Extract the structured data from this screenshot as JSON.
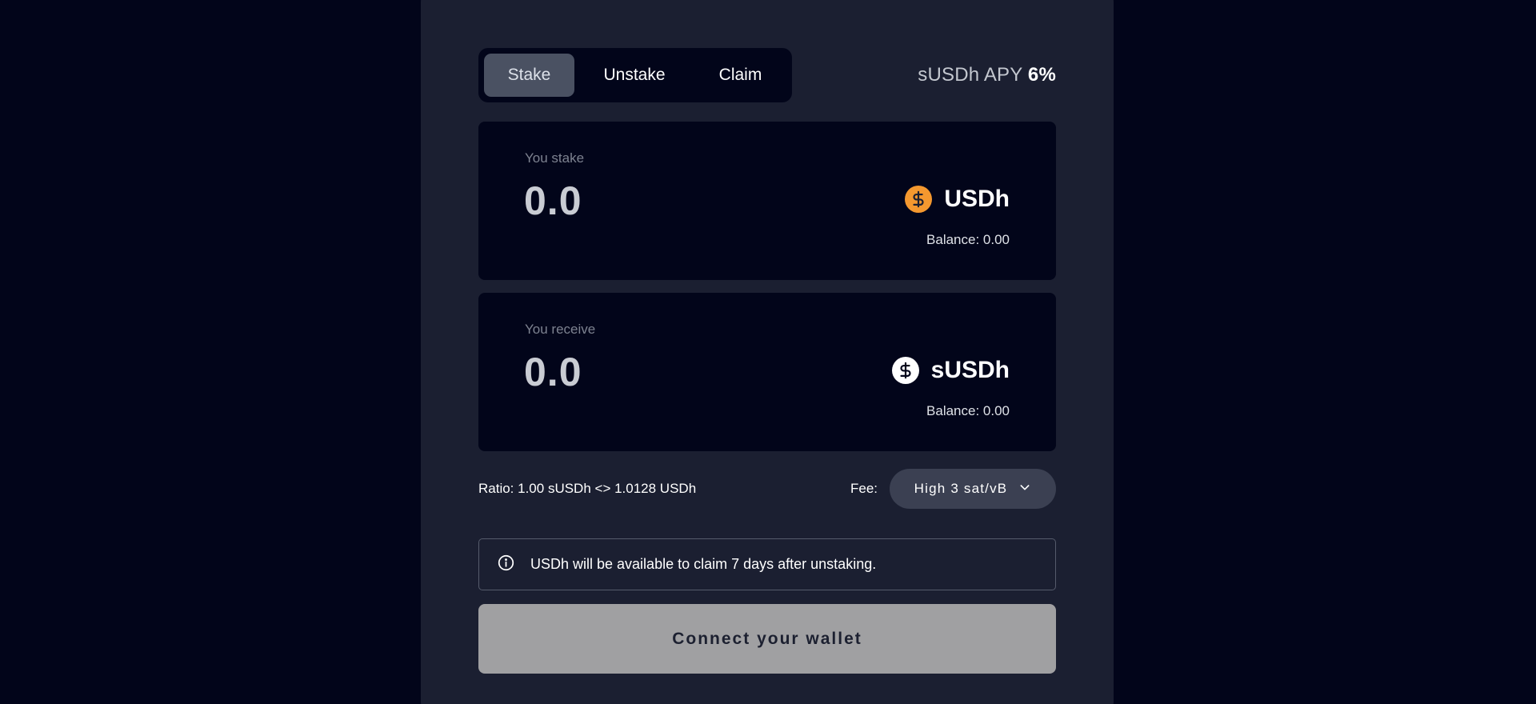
{
  "tabs": [
    {
      "label": "Stake",
      "active": true
    },
    {
      "label": "Unstake",
      "active": false
    },
    {
      "label": "Claim",
      "active": false
    }
  ],
  "apy": {
    "label": "sUSDh APY",
    "value": "6%"
  },
  "stake_card": {
    "label": "You stake",
    "amount": "0.0",
    "token": "USDh",
    "token_icon": "dollar-coin-orange-icon",
    "balance": "Balance: 0.00"
  },
  "receive_card": {
    "label": "You receive",
    "amount": "0.0",
    "token": "sUSDh",
    "token_icon": "dollar-coin-white-icon",
    "balance": "Balance: 0.00"
  },
  "ratio": "Ratio: 1.00 sUSDh <> 1.0128 USDh",
  "fee": {
    "label": "Fee:",
    "value": "High 3 sat/vB"
  },
  "info": {
    "icon": "info-icon",
    "text": "USDh will be available to claim 7 days after unstaking."
  },
  "connect_button": "Connect your wallet",
  "colors": {
    "background": "#02051a",
    "panel": "#1b1f31",
    "usdh_accent": "#f4982f",
    "active_tab": "#4a5162",
    "connect_button": "#a0a0a2"
  }
}
